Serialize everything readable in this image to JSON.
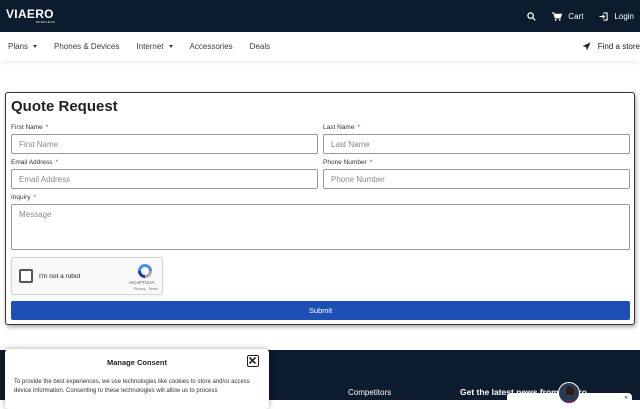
{
  "header": {
    "logo": "VIAERO",
    "logo_sub": "WIRELESS",
    "cart_label": "Cart",
    "login_label": "Login"
  },
  "nav": {
    "items": [
      {
        "label": "Plans",
        "dropdown": true
      },
      {
        "label": "Phones & Devices",
        "dropdown": false
      },
      {
        "label": "Internet",
        "dropdown": true
      },
      {
        "label": "Accessories",
        "dropdown": false
      },
      {
        "label": "Deals",
        "dropdown": false
      }
    ],
    "find_store": "Find a store"
  },
  "form": {
    "title": "Quote Request",
    "first_name": {
      "label": "First Name",
      "placeholder": "First Name"
    },
    "last_name": {
      "label": "Last Name",
      "placeholder": "Last Name"
    },
    "email": {
      "label": "Email Address",
      "placeholder": "Email Address"
    },
    "phone": {
      "label": "Phone Number",
      "placeholder": "Phone Number"
    },
    "inquiry": {
      "label": "Inquiry",
      "placeholder": "Message"
    },
    "required_mark": "*",
    "captcha": {
      "label": "I'm not a robot",
      "brand": "reCAPTCHA",
      "terms": "Privacy - Terms"
    },
    "submit_label": "Submit"
  },
  "footer": {
    "competitors": "Competitors",
    "news": "Get the latest news from Viaero"
  },
  "consent": {
    "title": "Manage Consent",
    "text": "To provide the best experiences, we use technologies like cookies to store and/or access device information. Consenting to these technologies will allow us to process"
  },
  "colors": {
    "header_bg": "#0d1b2e",
    "submit_bg": "#1e4fb5",
    "required": "#d23131"
  }
}
